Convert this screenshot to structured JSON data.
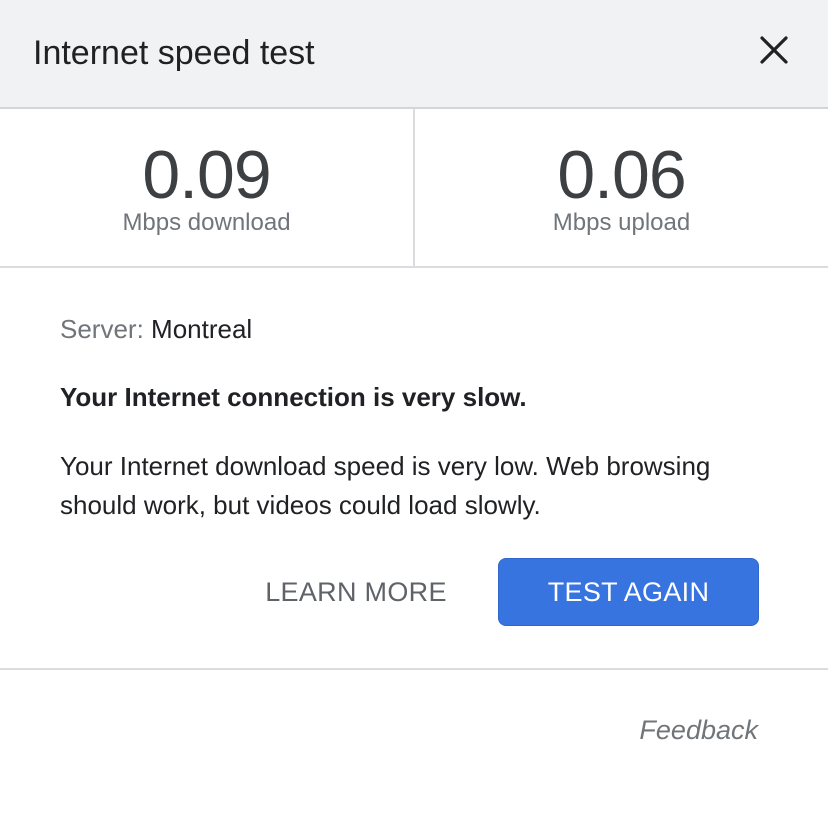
{
  "header": {
    "title": "Internet speed test",
    "close_icon": "close-icon"
  },
  "results": {
    "download": {
      "value": "0.09",
      "label": "Mbps download"
    },
    "upload": {
      "value": "0.06",
      "label": "Mbps upload"
    }
  },
  "server": {
    "label": "Server:",
    "value": "Montreal"
  },
  "message": {
    "headline": "Your Internet connection is very slow.",
    "description": "Your Internet download speed is very low. Web browsing should work, but videos could load slowly."
  },
  "actions": {
    "learn_more": "LEARN MORE",
    "test_again": "TEST AGAIN"
  },
  "footer": {
    "feedback": "Feedback"
  },
  "colors": {
    "header_bg": "#f1f2f4",
    "primary_button": "#3874e0",
    "secondary_text": "#70757a"
  }
}
